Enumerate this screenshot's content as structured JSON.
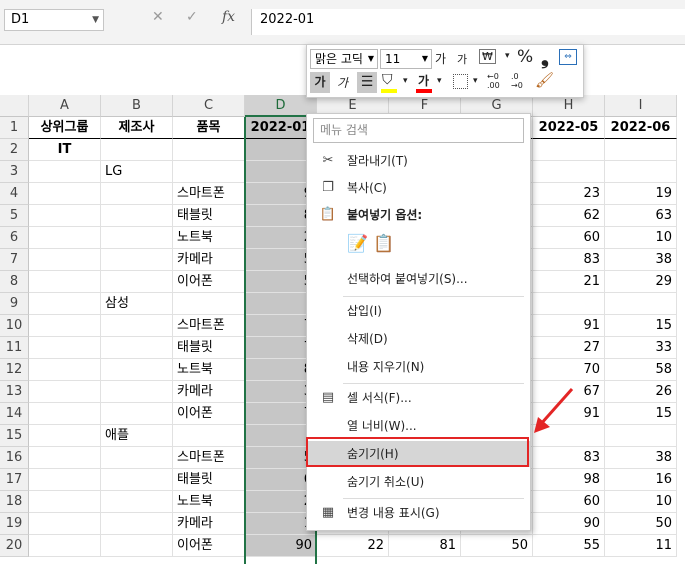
{
  "namebox": {
    "value": "D1"
  },
  "formula": {
    "value": "2022-01"
  },
  "formula_icons": {
    "cancel": "✕",
    "enter": "✓",
    "fx": "fx"
  },
  "columns": [
    "A",
    "B",
    "C",
    "D",
    "E",
    "F",
    "G",
    "H",
    "I"
  ],
  "selected_column": "D",
  "rows": [
    "1",
    "2",
    "3",
    "4",
    "5",
    "6",
    "7",
    "8",
    "9",
    "10",
    "11",
    "12",
    "13",
    "14",
    "15",
    "16",
    "17",
    "18",
    "19",
    "20"
  ],
  "header_row": {
    "a": "상위그룹",
    "b": "제조사",
    "c": "품목",
    "d": "2022-01",
    "h": "2022-05",
    "i": "2022-06"
  },
  "cells": [
    {
      "row": "2",
      "a": "IT",
      "b": "",
      "c": "",
      "d": "",
      "e": "",
      "f": "",
      "g": "",
      "h": "",
      "i": ""
    },
    {
      "row": "3",
      "a": "",
      "b": "LG",
      "c": "",
      "d": "",
      "e": "",
      "f": "",
      "g": "",
      "h": "",
      "i": ""
    },
    {
      "row": "4",
      "a": "",
      "b": "",
      "c": "스마트폰",
      "d": "9",
      "e": "",
      "f": "",
      "g": "",
      "h": "23",
      "i": "19"
    },
    {
      "row": "5",
      "a": "",
      "b": "",
      "c": "태블릿",
      "d": "8",
      "e": "",
      "f": "",
      "g": "",
      "h": "62",
      "i": "63"
    },
    {
      "row": "6",
      "a": "",
      "b": "",
      "c": "노트북",
      "d": "2",
      "e": "",
      "f": "",
      "g": "",
      "h": "60",
      "i": "10"
    },
    {
      "row": "7",
      "a": "",
      "b": "",
      "c": "카메라",
      "d": "5",
      "e": "",
      "f": "",
      "g": "",
      "h": "83",
      "i": "38"
    },
    {
      "row": "8",
      "a": "",
      "b": "",
      "c": "이어폰",
      "d": "5",
      "e": "",
      "f": "",
      "g": "",
      "h": "21",
      "i": "29"
    },
    {
      "row": "9",
      "a": "",
      "b": "삼성",
      "c": "",
      "d": "",
      "e": "",
      "f": "",
      "g": "",
      "h": "",
      "i": ""
    },
    {
      "row": "10",
      "a": "",
      "b": "",
      "c": "스마트폰",
      "d": "7",
      "e": "",
      "f": "",
      "g": "",
      "h": "91",
      "i": "15"
    },
    {
      "row": "11",
      "a": "",
      "b": "",
      "c": "태블릿",
      "d": "7",
      "e": "",
      "f": "",
      "g": "",
      "h": "27",
      "i": "33"
    },
    {
      "row": "12",
      "a": "",
      "b": "",
      "c": "노트북",
      "d": "8",
      "e": "",
      "f": "",
      "g": "",
      "h": "70",
      "i": "58"
    },
    {
      "row": "13",
      "a": "",
      "b": "",
      "c": "카메라",
      "d": "3",
      "e": "",
      "f": "",
      "g": "",
      "h": "67",
      "i": "26"
    },
    {
      "row": "14",
      "a": "",
      "b": "",
      "c": "이어폰",
      "d": "7",
      "e": "",
      "f": "",
      "g": "",
      "h": "91",
      "i": "15"
    },
    {
      "row": "15",
      "a": "",
      "b": "애플",
      "c": "",
      "d": "",
      "e": "",
      "f": "",
      "g": "",
      "h": "",
      "i": ""
    },
    {
      "row": "16",
      "a": "",
      "b": "",
      "c": "스마트폰",
      "d": "5",
      "e": "",
      "f": "",
      "g": "",
      "h": "83",
      "i": "38"
    },
    {
      "row": "17",
      "a": "",
      "b": "",
      "c": "태블릿",
      "d": "6",
      "e": "",
      "f": "",
      "g": "",
      "h": "98",
      "i": "16"
    },
    {
      "row": "18",
      "a": "",
      "b": "",
      "c": "노트북",
      "d": "2",
      "e": "",
      "f": "",
      "g": "",
      "h": "60",
      "i": "10"
    },
    {
      "row": "19",
      "a": "",
      "b": "",
      "c": "카메라",
      "d": "1",
      "e": "",
      "f": "",
      "g": "",
      "h": "90",
      "i": "50"
    },
    {
      "row": "20",
      "a": "",
      "b": "",
      "c": "이어폰",
      "d": "90",
      "e": "22",
      "f": "81",
      "g": "50",
      "h": "55",
      "i": "11"
    }
  ],
  "mini_toolbar": {
    "font_name": "맑은 고딕",
    "font_size": "11",
    "grow_font": "가",
    "shrink_font": "가",
    "percent": "%",
    "comma": "❟",
    "bold": "가",
    "italic": "가",
    "font_color_glyph": "가",
    "dec_increase": ".00",
    "dec_decrease": ".0",
    "fill_color": "#ffff00",
    "font_color": "#ff0000"
  },
  "context_menu": {
    "search_placeholder": "메뉴 검색",
    "cut": "잘라내기(T)",
    "copy": "복사(C)",
    "paste_options": "붙여넣기 옵션:",
    "paste_special": "선택하여 붙여넣기(S)...",
    "insert": "삽입(I)",
    "delete": "삭제(D)",
    "clear_contents": "내용 지우기(N)",
    "format_cells": "셀 서식(F)...",
    "column_width": "열 너비(W)...",
    "hide": "숨기기(H)",
    "unhide": "숨기기 취소(U)",
    "show_changes": "변경 내용 표시(G)"
  },
  "colors": {
    "excel_green": "#217346",
    "highlight_red": "#e32525",
    "selected_col_fill": "#c6c6c6"
  }
}
